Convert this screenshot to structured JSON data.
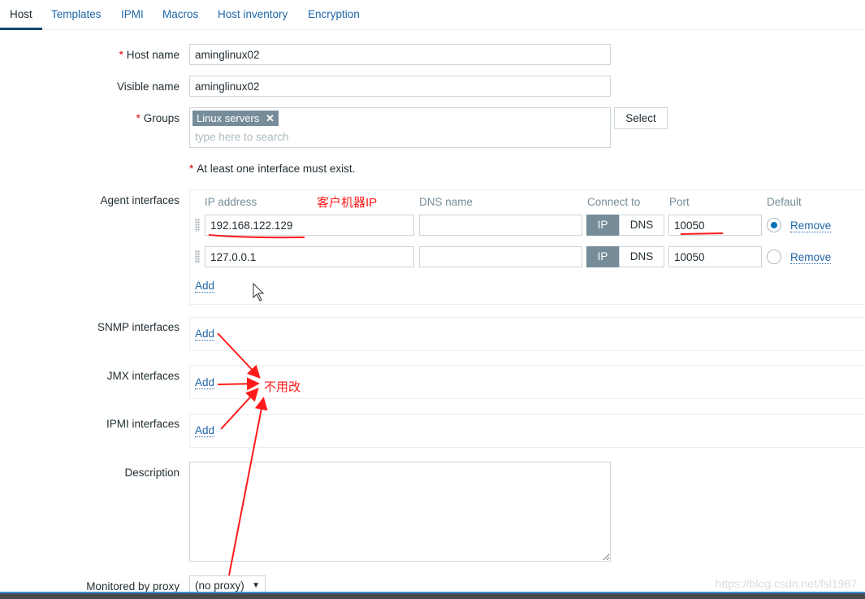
{
  "tabs": [
    "Host",
    "Templates",
    "IPMI",
    "Macros",
    "Host inventory",
    "Encryption"
  ],
  "form": {
    "host_name_label": "Host name",
    "host_name": "aminglinux02",
    "visible_name_label": "Visible name",
    "visible_name": "aminglinux02",
    "groups_label": "Groups",
    "group_tag": "Linux servers",
    "groups_placeholder": "type here to search",
    "select_button": "Select",
    "interface_note": "At least one interface must exist.",
    "required_mark": "*",
    "agent_label": "Agent interfaces",
    "headers": {
      "ip": "IP address",
      "dns": "DNS name",
      "connect": "Connect to",
      "port": "Port",
      "default": "Default"
    },
    "agent_rows": [
      {
        "ip": "192.168.122.129",
        "dns": "",
        "connect": "IP",
        "port": "10050",
        "default": true
      },
      {
        "ip": "127.0.0.1",
        "dns": "",
        "connect": "IP",
        "port": "10050",
        "default": false
      }
    ],
    "seg_ip": "IP",
    "seg_dns": "DNS",
    "remove": "Remove",
    "add": "Add",
    "snmp_label": "SNMP interfaces",
    "jmx_label": "JMX interfaces",
    "ipmi_label": "IPMI interfaces",
    "description_label": "Description",
    "description": "",
    "proxy_label": "Monitored by proxy",
    "proxy_value": "(no proxy)"
  },
  "annotations": {
    "client_ip": "客户机器IP",
    "no_change": "不用改",
    "color": "#ff1a1a"
  },
  "watermark": "https://blog.csdn.net/fsl1987"
}
